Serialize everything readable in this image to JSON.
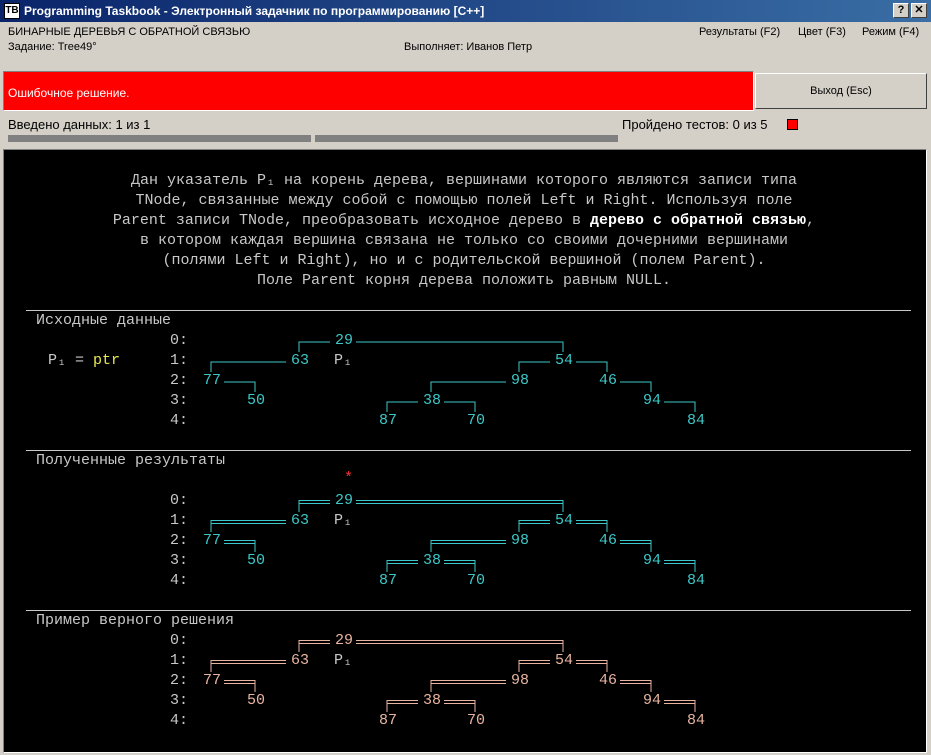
{
  "window": {
    "icon_label": "TB",
    "title": "Programming Taskbook - Электронный задачник по программированию [C++]",
    "help_btn": "?",
    "close_btn": "✕"
  },
  "header": {
    "group": "БИНАРНЫЕ ДЕРЕВЬЯ С ОБРАТНОЙ СВЯЗЬЮ",
    "task": "Задание: Tree49°",
    "performer": "Выполняет: Иванов Петр",
    "menu": {
      "results": "Результаты (F2)",
      "color": "Цвет (F3)",
      "mode": "Режим (F4)"
    }
  },
  "status": {
    "message": "Ошибочное решение.",
    "exit_label": "Выход (Esc)",
    "entered": "Введено данных: 1 из 1",
    "tests": "Пройдено тестов: 0 из 5",
    "entered_progress": 1.0,
    "tests_progress": 0.0
  },
  "task_text": {
    "line1": "Дан указатель P₁ на корень дерева, вершинами которого являются записи типа",
    "line2": "TNode, связанные между собой с помощью полей Left и Right. Используя поле",
    "line3a": "Parent записи TNode, преобразовать исходное дерево в ",
    "line3b": "дерево с обратной связью",
    "line3c": ",",
    "line4": "в котором каждая вершина связана не только со своими дочерними вершинами",
    "line5": "(полями Left и Right), но и с родительской вершиной (полем Parent).",
    "line6": "Поле Parent корня дерева положить равным NULL."
  },
  "sections": {
    "input": {
      "title": "Исходные данные",
      "pointer_label": "P₁ = ",
      "pointer_value": "ptr"
    },
    "results": {
      "title": "Полученные результаты",
      "marker": "*"
    },
    "example": {
      "title": "Пример верного решения"
    }
  },
  "levels": [
    "0:",
    "1:",
    "2:",
    "3:",
    "4:"
  ],
  "tree": {
    "root_label": "P₁",
    "nodes": [
      {
        "value": "29",
        "level": 0
      },
      {
        "value": "63",
        "level": 1
      },
      {
        "value": "54",
        "level": 1
      },
      {
        "value": "77",
        "level": 2
      },
      {
        "value": "98",
        "level": 2
      },
      {
        "value": "46",
        "level": 2
      },
      {
        "value": "50",
        "level": 3
      },
      {
        "value": "38",
        "level": 3
      },
      {
        "value": "94",
        "level": 3
      },
      {
        "value": "87",
        "level": 4
      },
      {
        "value": "70",
        "level": 4
      },
      {
        "value": "84",
        "level": 4
      }
    ]
  },
  "colors": {
    "error": "#ff0000",
    "tree_input": "#3cc8c8",
    "tree_result": "#3cc8c8",
    "tree_example": "#e8b4a0",
    "pointer": "#e8e850"
  }
}
